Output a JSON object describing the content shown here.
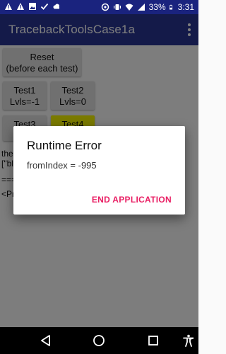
{
  "status_bar": {
    "battery_percent": "33%",
    "time": "3:31",
    "left_icons": [
      "alert-icon",
      "alert-icon",
      "image-icon",
      "check-icon",
      "cloud-icon"
    ],
    "right_icons": [
      "location-icon",
      "vibrate-icon",
      "wifi-icon",
      "signal-icon",
      "battery-icon"
    ]
  },
  "app_bar": {
    "title": "TracebackToolsCase1a"
  },
  "buttons": {
    "reset": [
      "Reset",
      "(before each test)"
    ],
    "test1": [
      "Test1",
      "Lvls=-1"
    ],
    "test2": [
      "Test2",
      "Lvls=0"
    ],
    "test3": [
      "Test3"
    ],
    "test4": [
      "Test4"
    ]
  },
  "log_lines": [
    "the",
    "[\"bl",
    "===",
    "<Pr"
  ],
  "dialog": {
    "title": "Runtime Error",
    "message": "fromIndex = -995",
    "action": "END APPLICATION"
  },
  "nav_bar": {
    "buttons": [
      "back-icon",
      "home-icon",
      "recents-icon",
      "accessibility-icon"
    ]
  },
  "colors": {
    "status_bar": "#1a237e",
    "app_bar": "#283593",
    "dialog_action": "#e91e63",
    "test4_button": "#f5f500"
  }
}
